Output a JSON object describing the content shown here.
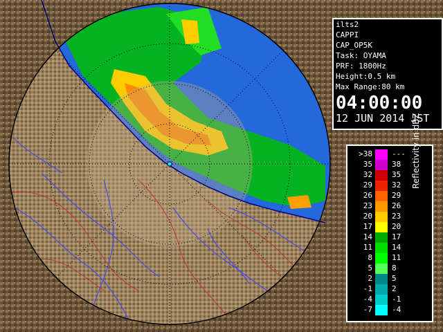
{
  "info": {
    "lines": [
      "ilts2",
      "CAPPI",
      "CAP_OP5K",
      "Task: OYAMA",
      "PRF: 1800Hz",
      "Height:0.5 km",
      "Max Range:80 km"
    ],
    "time": "04:00:00",
    "date": "12 JUN 2014 JST"
  },
  "legend": {
    "title": "Reflectivity in dBZ",
    "bins": [
      {
        "low": ">38",
        "high": "---",
        "color": "#ff00ff"
      },
      {
        "low": "35",
        "high": "38",
        "color": "#cc00cc"
      },
      {
        "low": "32",
        "high": "35",
        "color": "#cc0000"
      },
      {
        "low": "29",
        "high": "32",
        "color": "#ee2200"
      },
      {
        "low": "26",
        "high": "29",
        "color": "#ff6600"
      },
      {
        "low": "23",
        "high": "26",
        "color": "#ff9900"
      },
      {
        "low": "20",
        "high": "23",
        "color": "#ffcc00"
      },
      {
        "low": "17",
        "high": "20",
        "color": "#ffff00"
      },
      {
        "low": "14",
        "high": "17",
        "color": "#00aa00"
      },
      {
        "low": "11",
        "high": "14",
        "color": "#00dd00"
      },
      {
        "low": "8",
        "high": "11",
        "color": "#00ff00"
      },
      {
        "low": "5",
        "high": "8",
        "color": "#55ff55"
      },
      {
        "low": "2",
        "high": "5",
        "color": "#008888"
      },
      {
        "low": "-1",
        "high": "2",
        "color": "#00aaaa"
      },
      {
        "low": "-4",
        "high": "-1",
        "color": "#00cccc"
      },
      {
        "low": "-7",
        "high": "-4",
        "color": "#00ffff"
      }
    ]
  },
  "colors": {
    "sea": "#2060d8",
    "land_dark": "#5a4630",
    "land_light": "#b49b70",
    "river": "#4a4af0",
    "boundary": "#c03030",
    "range_ring": "#000000"
  }
}
